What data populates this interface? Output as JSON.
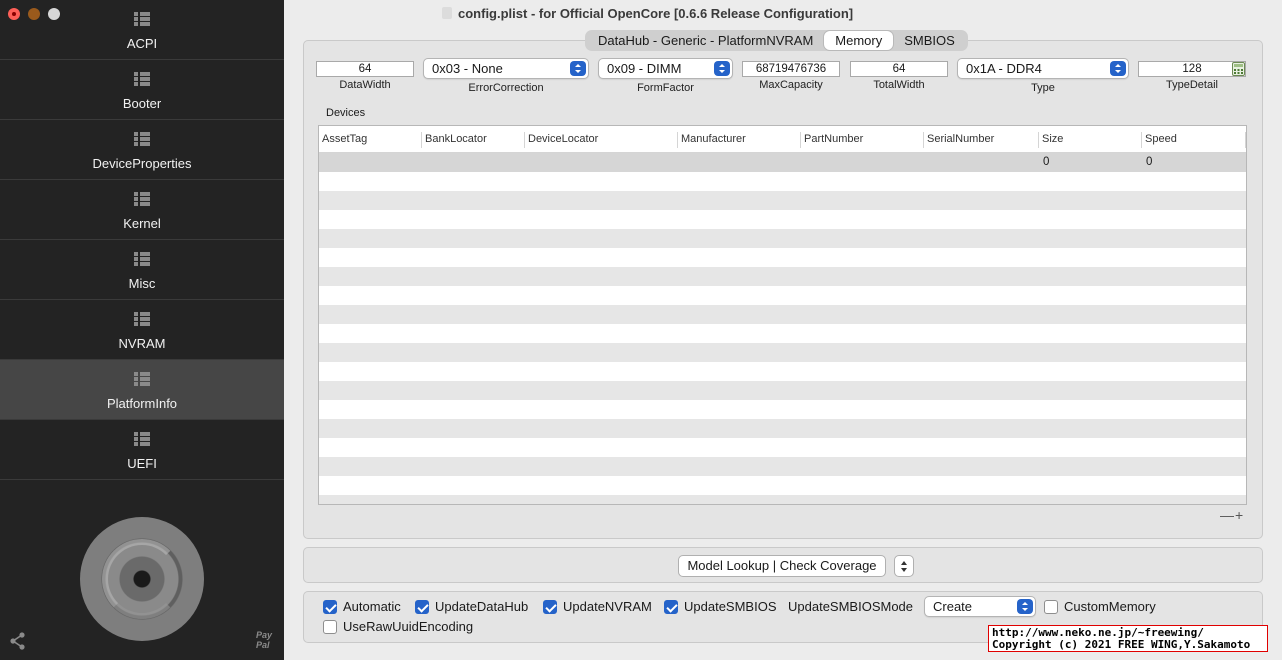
{
  "window": {
    "title": "config.plist - for Official OpenCore [0.6.6 Release Configuration]"
  },
  "sidebar": {
    "items": [
      {
        "label": "ACPI"
      },
      {
        "label": "Booter"
      },
      {
        "label": "DeviceProperties"
      },
      {
        "label": "Kernel"
      },
      {
        "label": "Misc"
      },
      {
        "label": "NVRAM"
      },
      {
        "label": "PlatformInfo",
        "active": true
      },
      {
        "label": "UEFI"
      }
    ],
    "paypal": [
      "Pay",
      "Pal"
    ]
  },
  "tabs": [
    {
      "label": "DataHub - Generic - PlatformNVRAM"
    },
    {
      "label": "Memory",
      "selected": true
    },
    {
      "label": "SMBIOS"
    }
  ],
  "memory": {
    "data_width": {
      "value": "64",
      "label": "DataWidth"
    },
    "error_correction": {
      "value": "0x03 - None",
      "label": "ErrorCorrection"
    },
    "form_factor": {
      "value": "0x09 - DIMM",
      "label": "FormFactor"
    },
    "max_capacity": {
      "value": "68719476736",
      "label": "MaxCapacity"
    },
    "total_width": {
      "value": "64",
      "label": "TotalWidth"
    },
    "type": {
      "value": "0x1A - DDR4",
      "label": "Type"
    },
    "type_detail": {
      "value": "128",
      "label": "TypeDetail"
    }
  },
  "devices": {
    "label": "Devices",
    "columns": [
      "AssetTag",
      "BankLocator",
      "DeviceLocator",
      "Manufacturer",
      "PartNumber",
      "SerialNumber",
      "Size",
      "Speed"
    ],
    "rows": [
      [
        "",
        "",
        "",
        "",
        "",
        "",
        "0",
        "0"
      ]
    ],
    "controls": "—+"
  },
  "lookup": {
    "button_label": "Model Lookup | Check Coverage"
  },
  "options": {
    "automatic": {
      "label": "Automatic",
      "checked": true
    },
    "update_datahub": {
      "label": "UpdateDataHub",
      "checked": true
    },
    "update_nvram": {
      "label": "UpdateNVRAM",
      "checked": true
    },
    "update_smbios": {
      "label": "UpdateSMBIOS",
      "checked": true
    },
    "update_smbios_mode_label": "UpdateSMBIOSMode",
    "update_smbios_mode_value": "Create",
    "custom_memory": {
      "label": "CustomMemory",
      "checked": false
    },
    "use_raw_uuid": {
      "label": "UseRawUuidEncoding",
      "checked": false
    }
  },
  "watermark": {
    "line1": "http://www.neko.ne.jp/~freewing/",
    "line2": "Copyright (c) 2021 FREE WING,Y.Sakamoto"
  },
  "colors": {
    "accent": "#2563c9",
    "sidebar_bg": "#232323",
    "sidebar_active": "#464646"
  }
}
